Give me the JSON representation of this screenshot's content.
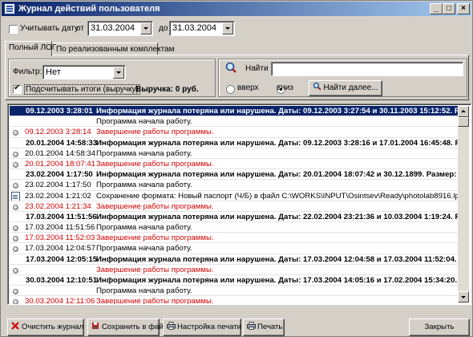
{
  "window": {
    "title": "Журнал действий пользователя"
  },
  "date_filter": {
    "use_date_label": "Учитывать дату",
    "from_label": "от",
    "from_value": "31.03.2004",
    "to_label": "до",
    "to_value": "31.03.2004"
  },
  "tabs": [
    {
      "label": "Полный ЛОГ"
    },
    {
      "label": "По реализованным комплектам"
    }
  ],
  "filter": {
    "label": "Фильтр:",
    "value": "Нет"
  },
  "totals": {
    "checkbox_label": "Подсчитывать итоги (выручку)",
    "revenue_text": "Выручка: 0 руб."
  },
  "search": {
    "label": "Найти",
    "value": "",
    "up_label": "вверх",
    "down_label": "вниз",
    "direction_selected": "вниз",
    "find_next_label": "Найти далее..."
  },
  "log_rows": [
    {
      "date": "09.12.2003 3:28:01",
      "text": "Информация журнала потеряна или нарушена. Даты: 09.12.2003 3:27:54 и 30.11.2003 15:12:52. Размер:",
      "style": "sel",
      "icon": "none"
    },
    {
      "date": "",
      "text": "Программа начала работу.",
      "style": "normal",
      "icon": "none"
    },
    {
      "date": "09.12.2003 3:28:14",
      "text": "Завершение работы программы.",
      "style": "red",
      "icon": "dot"
    },
    {
      "date": "20.01.2004 14:58:33",
      "text": "Информация журнала потеряна или нарушена. Даты: 09.12.2003 3:28:16 и 17.01.2004 16:45:48. Размер: 1",
      "style": "bold",
      "icon": "none"
    },
    {
      "date": "20.01.2004 14:58:34",
      "text": "Программа начала работу.",
      "style": "normal",
      "icon": "dot"
    },
    {
      "date": "20.01.2004 18:07:41",
      "text": "Завершение работы программы.",
      "style": "red",
      "icon": "dot"
    },
    {
      "date": "23.02.2004 1:17:50",
      "text": "Информация журнала потеряна или нарушена. Даты: 20.01.2004 18:07:42 и 30.12.1899. Размер: -1 и 237",
      "style": "bold",
      "icon": "none"
    },
    {
      "date": "23.02.2004 1:17:50",
      "text": "Программа начала работу.",
      "style": "normal",
      "icon": "dot"
    },
    {
      "date": "23.02.2004 1:21:02",
      "text": "Сохранение формата: Новый паспорт (Ч/Б) в файл C:\\WORKS\\INPUT\\Osintsev\\Ready\\photolab8916.lp_04.",
      "style": "normal",
      "icon": "doc"
    },
    {
      "date": "23.02.2004 1:21:34",
      "text": "Завершение работы программы.",
      "style": "red",
      "icon": "dot"
    },
    {
      "date": "17.03.2004 11:51:56",
      "text": "Информация журнала потеряна или нарушена. Даты: 22.02.2004 23:21:36 и 10.03.2004 1:19:24. Размер:",
      "style": "bold",
      "icon": "none"
    },
    {
      "date": "17.03.2004 11:51:56",
      "text": "Программа начала работу.",
      "style": "normal",
      "icon": "dot"
    },
    {
      "date": "17.03.2004 11:52:03",
      "text": "Завершение работы программы.",
      "style": "red",
      "icon": "dot"
    },
    {
      "date": "17.03.2004 12:04:57",
      "text": "Программа начала работу.",
      "style": "normal",
      "icon": "dot"
    },
    {
      "date": "17.03.2004 12:05:15",
      "text": "Информация журнала потеряна или нарушена. Даты: 17.03.2004 12:04:58 и 17.03.2004 11:52:04. Размер",
      "style": "bold",
      "icon": "none"
    },
    {
      "date": "",
      "text": "Завершение работы программы.",
      "style": "red",
      "icon": "dot"
    },
    {
      "date": "30.03.2004 12:10:51",
      "text": "Информация журнала потеряна или нарушена. Даты: 17.03.2004 14:05:16 и 17.02.2004 15:34:20. Размер",
      "style": "bold",
      "icon": "none"
    },
    {
      "date": "",
      "text": "Программа начала работу.",
      "style": "normal",
      "icon": "dot"
    },
    {
      "date": "30.03.2004 12:11:06",
      "text": "Завершение работы программы.",
      "style": "red",
      "icon": "dot"
    }
  ],
  "buttons": {
    "clear": "Очистить журнал",
    "save": "Сохранить в файл",
    "print_setup": "Настройка печати",
    "print": "Печать",
    "close": "Закрыть"
  }
}
